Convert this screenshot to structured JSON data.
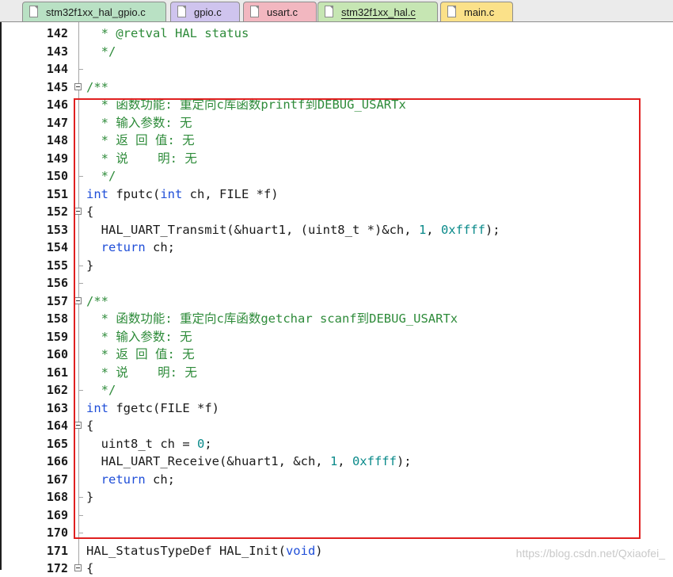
{
  "tabs": [
    {
      "label": "stm32f1xx_hal_gpio.c",
      "color": "#b9e1c4",
      "active": false
    },
    {
      "label": "gpio.c",
      "color": "#cfc4ee",
      "active": false
    },
    {
      "label": "usart.c",
      "color": "#f2b7c0",
      "active": false
    },
    {
      "label": "stm32f1xx_hal.c",
      "color": "#c6e6b3",
      "active": true
    },
    {
      "label": "main.c",
      "color": "#fbe189",
      "active": false
    }
  ],
  "colors": {
    "keyword": "#1f4ed8",
    "comment": "#2e8b3a",
    "number": "#0a8a8a",
    "text": "#1a1a1a",
    "highlight": "#e02020"
  },
  "watermark": "https://blog.csdn.net/Qxiaofei_",
  "lines": [
    {
      "num": "142",
      "fold": "",
      "tokens": [
        [
          "cm",
          "  * @retval HAL status"
        ]
      ]
    },
    {
      "num": "143",
      "fold": "",
      "tokens": [
        [
          "cm",
          "  */"
        ]
      ]
    },
    {
      "num": "144",
      "fold": "end",
      "tokens": []
    },
    {
      "num": "145",
      "fold": "open",
      "tokens": [
        [
          "cm",
          "/**"
        ]
      ]
    },
    {
      "num": "146",
      "fold": "",
      "tokens": [
        [
          "cm",
          "  * 函数功能: 重定向c库函数printf到DEBUG_USARTx"
        ]
      ]
    },
    {
      "num": "147",
      "fold": "",
      "tokens": [
        [
          "cm",
          "  * 输入参数: 无"
        ]
      ]
    },
    {
      "num": "148",
      "fold": "",
      "tokens": [
        [
          "cm",
          "  * 返 回 值: 无"
        ]
      ]
    },
    {
      "num": "149",
      "fold": "",
      "tokens": [
        [
          "cm",
          "  * 说    明: 无"
        ]
      ]
    },
    {
      "num": "150",
      "fold": "end",
      "tokens": [
        [
          "cm",
          "  */"
        ]
      ]
    },
    {
      "num": "151",
      "fold": "",
      "tokens": [
        [
          "kw",
          "int"
        ],
        [
          "tx",
          " fputc("
        ],
        [
          "kw",
          "int"
        ],
        [
          "tx",
          " ch, FILE *f)"
        ]
      ]
    },
    {
      "num": "152",
      "fold": "open",
      "tokens": [
        [
          "tx",
          "{"
        ]
      ]
    },
    {
      "num": "153",
      "fold": "",
      "tokens": [
        [
          "tx",
          "  HAL_UART_Transmit(&huart1, (uint8_t *)&ch, "
        ],
        [
          "num",
          "1"
        ],
        [
          "tx",
          ", "
        ],
        [
          "num",
          "0xffff"
        ],
        [
          "tx",
          ");"
        ]
      ]
    },
    {
      "num": "154",
      "fold": "",
      "tokens": [
        [
          "tx",
          "  "
        ],
        [
          "kw",
          "return"
        ],
        [
          "tx",
          " ch;"
        ]
      ]
    },
    {
      "num": "155",
      "fold": "end",
      "tokens": [
        [
          "tx",
          "}"
        ]
      ]
    },
    {
      "num": "156",
      "fold": "end",
      "tokens": []
    },
    {
      "num": "157",
      "fold": "open",
      "tokens": [
        [
          "cm",
          "/**"
        ]
      ]
    },
    {
      "num": "158",
      "fold": "",
      "tokens": [
        [
          "cm",
          "  * 函数功能: 重定向c库函数getchar scanf到DEBUG_USARTx"
        ]
      ]
    },
    {
      "num": "159",
      "fold": "",
      "tokens": [
        [
          "cm",
          "  * 输入参数: 无"
        ]
      ]
    },
    {
      "num": "160",
      "fold": "",
      "tokens": [
        [
          "cm",
          "  * 返 回 值: 无"
        ]
      ]
    },
    {
      "num": "161",
      "fold": "",
      "tokens": [
        [
          "cm",
          "  * 说    明: 无"
        ]
      ]
    },
    {
      "num": "162",
      "fold": "end",
      "tokens": [
        [
          "cm",
          "  */"
        ]
      ]
    },
    {
      "num": "163",
      "fold": "",
      "tokens": [
        [
          "kw",
          "int"
        ],
        [
          "tx",
          " fgetc(FILE *f)"
        ]
      ]
    },
    {
      "num": "164",
      "fold": "open",
      "tokens": [
        [
          "tx",
          "{"
        ]
      ]
    },
    {
      "num": "165",
      "fold": "",
      "tokens": [
        [
          "tx",
          "  uint8_t ch = "
        ],
        [
          "num",
          "0"
        ],
        [
          "tx",
          ";"
        ]
      ]
    },
    {
      "num": "166",
      "fold": "",
      "tokens": [
        [
          "tx",
          "  HAL_UART_Receive(&huart1, &ch, "
        ],
        [
          "num",
          "1"
        ],
        [
          "tx",
          ", "
        ],
        [
          "num",
          "0xffff"
        ],
        [
          "tx",
          ");"
        ]
      ]
    },
    {
      "num": "167",
      "fold": "",
      "tokens": [
        [
          "tx",
          "  "
        ],
        [
          "kw",
          "return"
        ],
        [
          "tx",
          " ch;"
        ]
      ]
    },
    {
      "num": "168",
      "fold": "end",
      "tokens": [
        [
          "tx",
          "}"
        ]
      ]
    },
    {
      "num": "169",
      "fold": "end",
      "tokens": []
    },
    {
      "num": "170",
      "fold": "end",
      "tokens": []
    },
    {
      "num": "171",
      "fold": "",
      "tokens": [
        [
          "tx",
          "HAL_StatusTypeDef HAL_Init("
        ],
        [
          "kw",
          "void"
        ],
        [
          "tx",
          ")"
        ]
      ]
    },
    {
      "num": "172",
      "fold": "open",
      "tokens": [
        [
          "tx",
          "{"
        ]
      ]
    }
  ]
}
